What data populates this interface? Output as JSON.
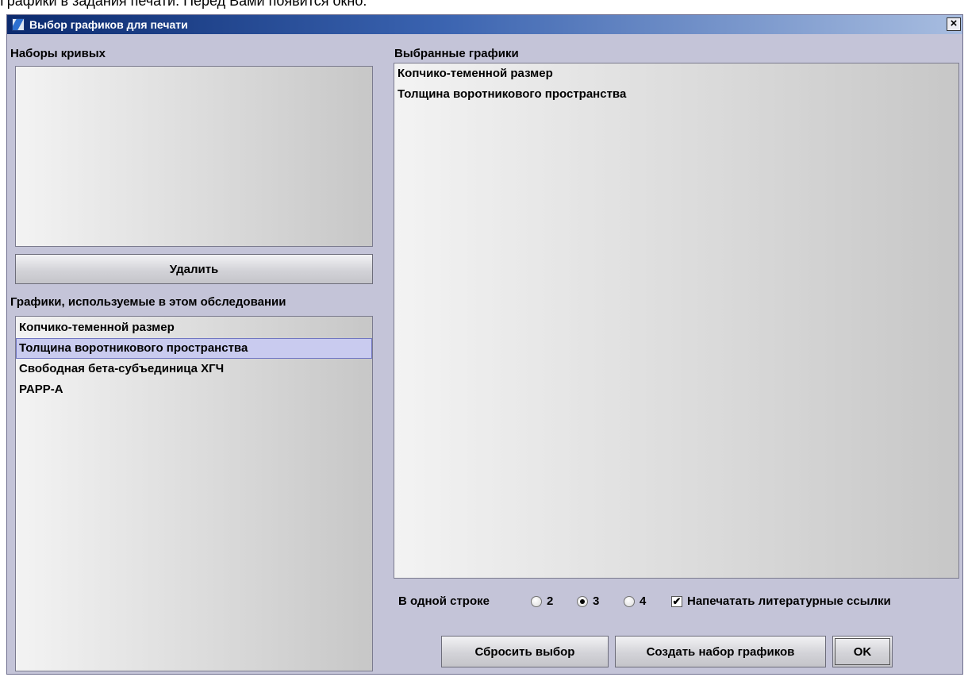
{
  "document_text": "Графики в задания печати. Перед Вами появится окно:",
  "dialog": {
    "title": "Выбор графиков для печати",
    "close_label": "×"
  },
  "curve_sets": {
    "label": "Наборы кривых",
    "items": []
  },
  "delete_button": "Удалить",
  "exam_charts": {
    "label": "Графики, используемые в этом обследовании",
    "items": [
      "Копчико-теменной размер",
      "Толщина воротникового пространства",
      "Свободная бета-субъединица ХГЧ",
      "PAPP-A"
    ],
    "selected_index": 1
  },
  "selected_charts": {
    "label": "Выбранные графики",
    "items": [
      "Копчико-теменной размер",
      "Толщина воротникового пространства"
    ]
  },
  "per_row": {
    "label": "В одной строке",
    "options": [
      "2",
      "3",
      "4"
    ],
    "selected": "3"
  },
  "print_refs": {
    "label": "Напечатать литературные ссылки",
    "checked": true,
    "check_glyph": "✔"
  },
  "buttons": {
    "reset": "Сбросить выбор",
    "create_set": "Создать набор графиков",
    "ok": "OK"
  },
  "colors": {
    "dialog_bg": "#c4c4d8",
    "title_gradient_start": "#0b2a6e",
    "selection_bg": "#c9cbef"
  },
  "icons": [
    "app-icon",
    "close-icon",
    "checkmark-icon"
  ]
}
